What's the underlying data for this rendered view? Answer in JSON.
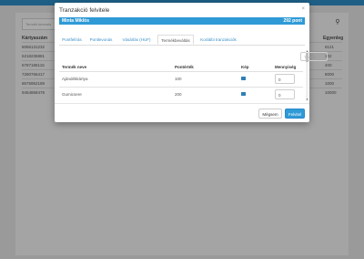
{
  "background": {
    "search_placeholder": "Termék keresés",
    "columns": [
      "Kártyaszám",
      "Egyenleg"
    ],
    "rows": [
      [
        "6056131232",
        "6121"
      ],
      [
        "6218236881",
        "102"
      ],
      [
        "6787186115",
        "400"
      ],
      [
        "7280766417",
        "8000"
      ],
      [
        "8675952189",
        "1000"
      ],
      [
        "9464868478",
        "10000"
      ]
    ]
  },
  "modal": {
    "title": "Tranzakció felvitele",
    "close_glyph": "×",
    "customer_name": "Minta Miklós",
    "points": "292 pont",
    "tabs": [
      "Pontfelírás",
      "Pontlevonás",
      "Vásárlás (HUF)",
      "Termékbeváltás",
      "Korábbi tranzakciók"
    ],
    "active_tab": "Termékbeváltás",
    "filter_placeholder": "Termék",
    "table": {
      "headers": [
        "Termék neve",
        "Pontérték",
        "Kép",
        "Mennyiség"
      ],
      "rows": [
        {
          "name": "Ajándékkártya",
          "value": "100",
          "qty": "0"
        },
        {
          "name": "Gumicsere",
          "value": "200",
          "qty": "0"
        }
      ]
    },
    "cancel_label": "Mégsem",
    "submit_label": "Felvitel"
  }
}
